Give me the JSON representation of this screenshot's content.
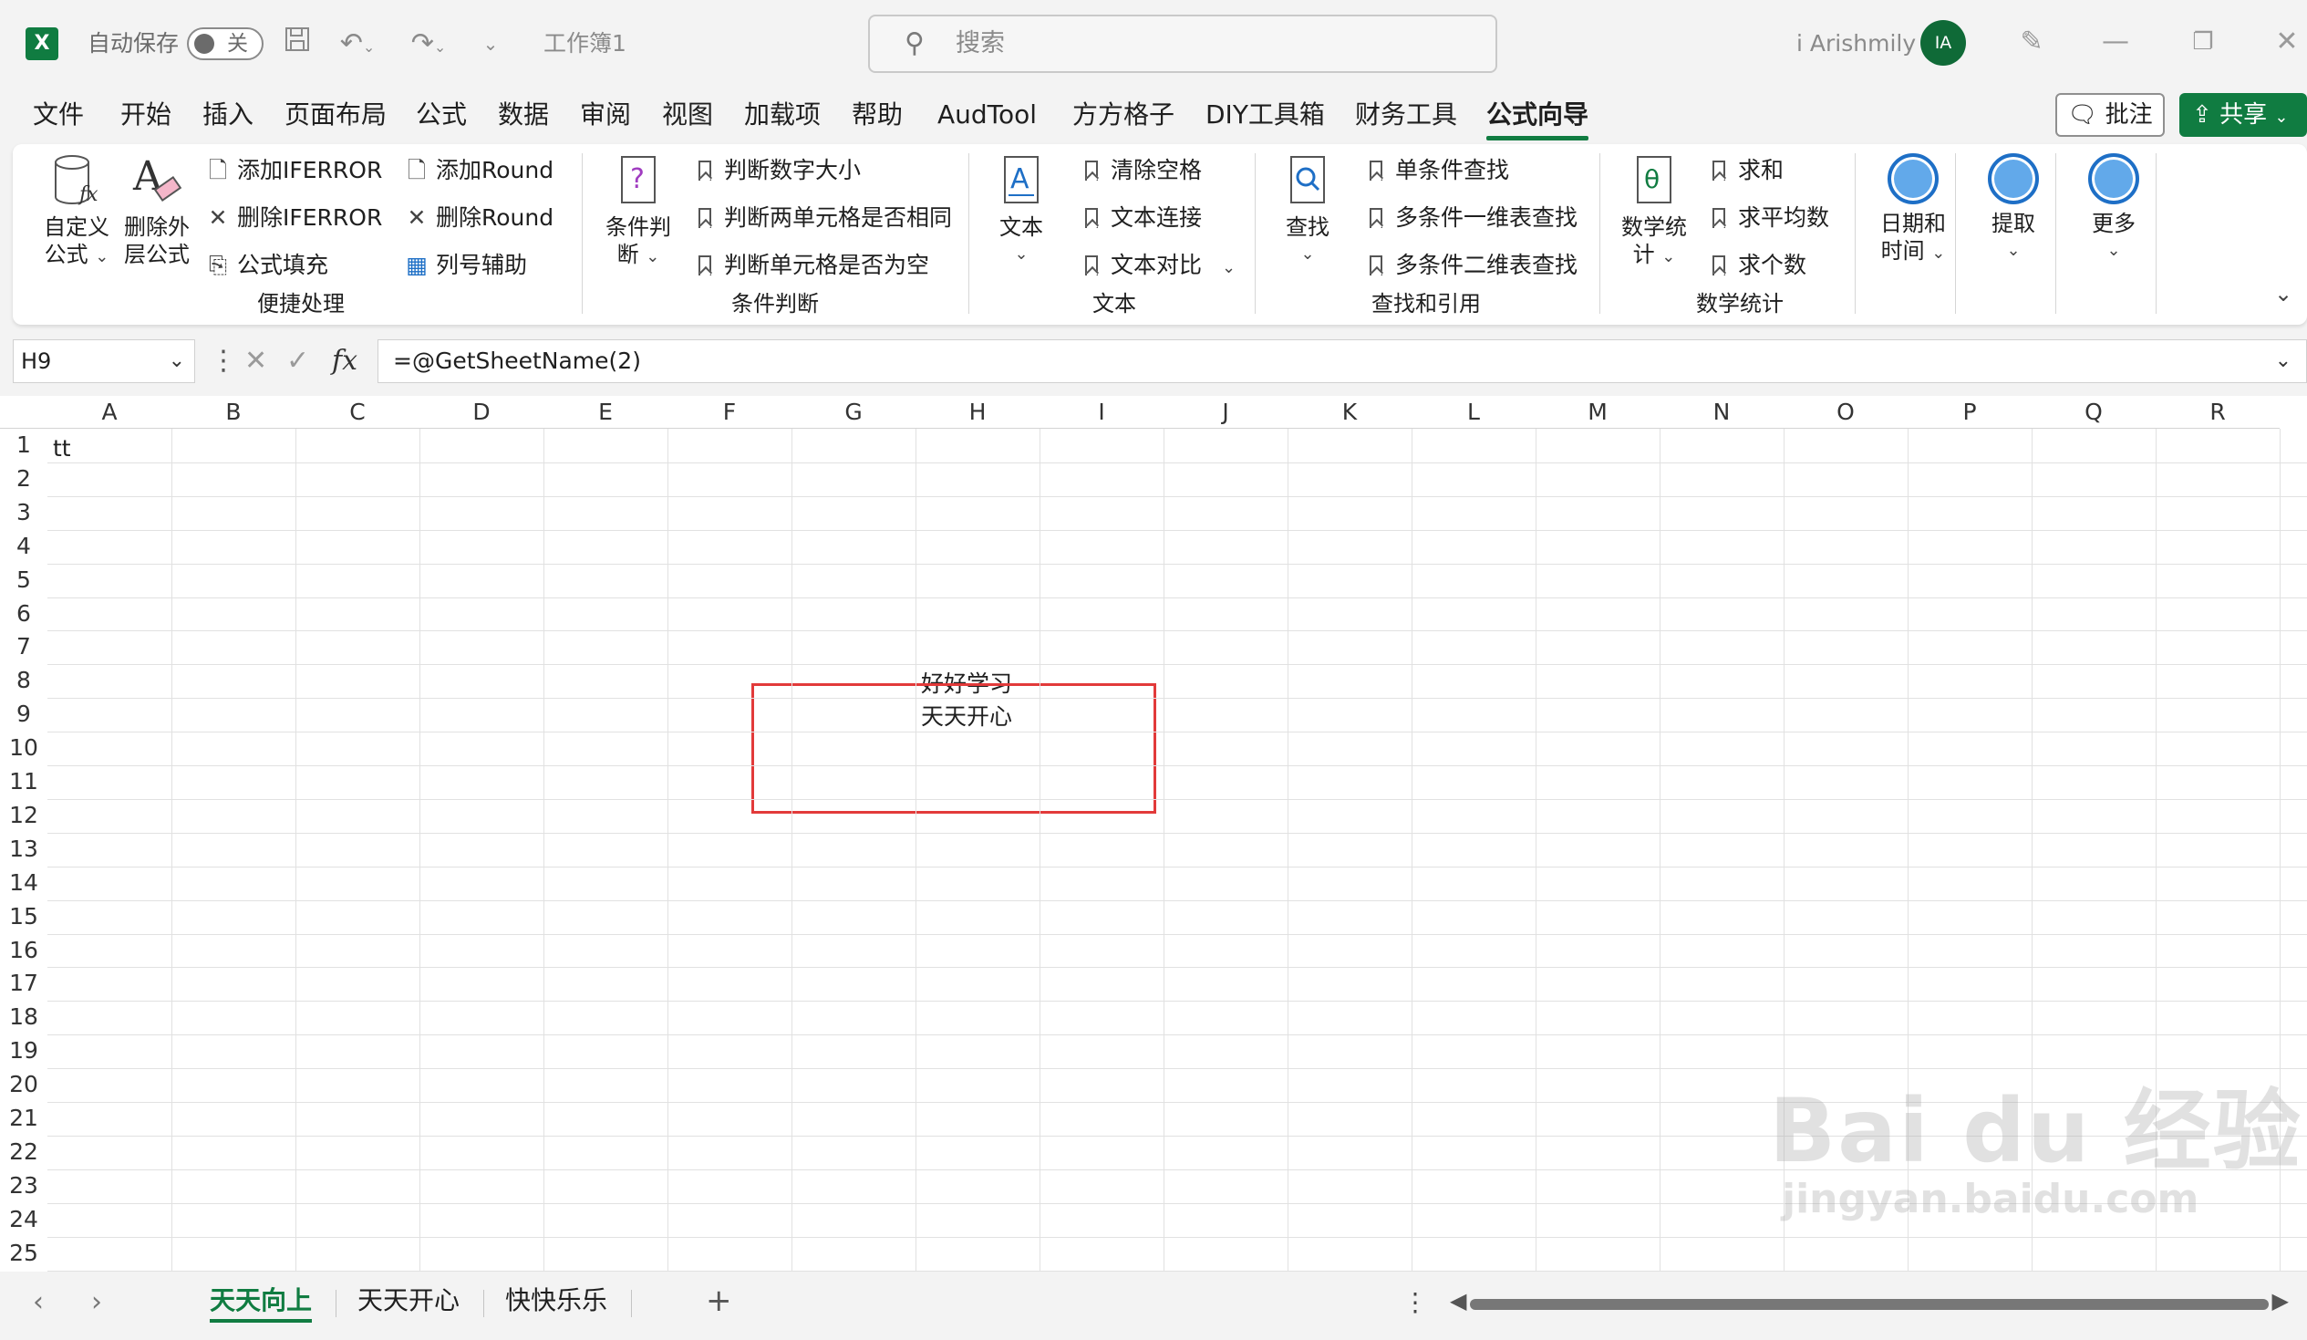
{
  "titlebar": {
    "autosave_label": "自动保存",
    "autosave_state": "关",
    "doc_title": "工作簿1",
    "search_placeholder": "搜索",
    "user_name": "i Arishmily",
    "avatar_initials": "IA"
  },
  "menu": {
    "tabs": [
      "文件",
      "开始",
      "插入",
      "页面布局",
      "公式",
      "数据",
      "审阅",
      "视图",
      "加载项",
      "帮助",
      "AudTool",
      "方方格子",
      "DIY工具箱",
      "财务工具",
      "公式向导"
    ],
    "active_tab": "公式向导",
    "comment_label": "批注",
    "share_label": "共享"
  },
  "ribbon": {
    "groups": {
      "convenience": {
        "label": "便捷处理",
        "big": [
          "自定义公式",
          "删除外层公式"
        ],
        "big_lines": [
          [
            "自定义",
            "公式"
          ],
          [
            "删除外",
            "层公式"
          ]
        ],
        "small": [
          "添加IFERROR",
          "删除IFERROR",
          "公式填充",
          "添加Round",
          "删除Round",
          "列号辅助"
        ]
      },
      "condition": {
        "label": "条件判断",
        "big_lines": [
          "条件判",
          "断"
        ],
        "small": [
          "判断数字大小",
          "判断两单元格是否相同",
          "判断单元格是否为空"
        ]
      },
      "text": {
        "label": "文本",
        "big": "文本",
        "small": [
          "清除空格",
          "文本连接",
          "文本对比"
        ]
      },
      "lookup": {
        "label": "查找和引用",
        "big": "查找",
        "small": [
          "单条件查找",
          "多条件一维表查找",
          "多条件二维表查找"
        ]
      },
      "math": {
        "label": "数学统计",
        "big_lines": [
          "数学统",
          "计"
        ],
        "small": [
          "求和",
          "求平均数",
          "求个数"
        ]
      },
      "date": {
        "big_lines": [
          "日期和",
          "时间"
        ]
      },
      "extract": {
        "big": "提取"
      },
      "more": {
        "big": "更多"
      }
    }
  },
  "formula_bar": {
    "name_box": "H9",
    "formula": "=@GetSheetName(2)"
  },
  "sheet": {
    "columns": [
      "A",
      "B",
      "C",
      "D",
      "E",
      "F",
      "G",
      "H",
      "I",
      "J",
      "K",
      "L",
      "M",
      "N",
      "O",
      "P",
      "Q",
      "R"
    ],
    "rows": [
      "1",
      "2",
      "3",
      "4",
      "5",
      "6",
      "7",
      "8",
      "9",
      "10",
      "11",
      "12",
      "13",
      "14",
      "15",
      "16",
      "17",
      "18",
      "19",
      "20",
      "21",
      "22",
      "23",
      "24",
      "25"
    ],
    "cell_A1": "tt",
    "cell_H8": "好好学习",
    "cell_H9": "天天开心"
  },
  "sheet_tabs": {
    "tabs": [
      "天天向上",
      "天天开心",
      "快快乐乐"
    ],
    "active": "天天向上"
  },
  "watermark": {
    "line1": "Bai du 经验",
    "line2": "jingyan.baidu.com"
  },
  "colors": {
    "accent": "#107c41",
    "highlight_box": "#e23a3a"
  }
}
